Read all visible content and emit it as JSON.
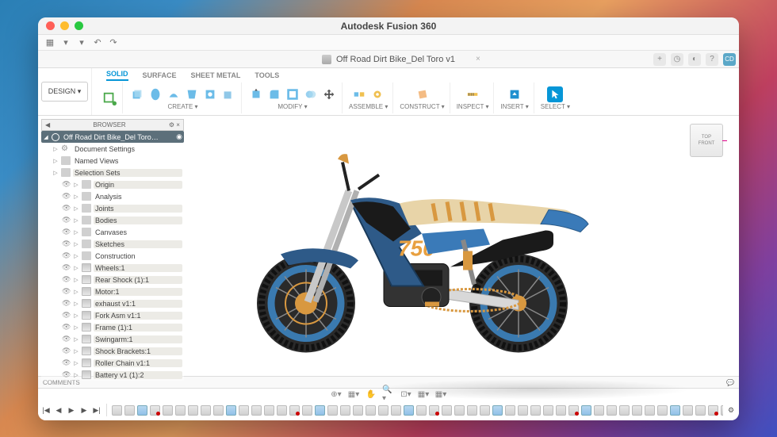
{
  "window_title": "Autodesk Fusion 360",
  "document_tab": "Off Road Dirt Bike_Del Toro v1",
  "user_initials": "CD",
  "design_button": "DESIGN ▾",
  "ribbon_tabs": [
    "SOLID",
    "SURFACE",
    "SHEET METAL",
    "TOOLS"
  ],
  "ribbon_active_tab": 0,
  "ribbon_groups": {
    "create": "CREATE ▾",
    "modify": "MODIFY ▾",
    "assemble": "ASSEMBLE ▾",
    "construct": "CONSTRUCT ▾",
    "inspect": "INSPECT ▾",
    "insert": "INSERT ▾",
    "select": "SELECT ▾"
  },
  "browser_header": "BROWSER",
  "browser": {
    "root": "Off Road Dirt Bike_Del Toro…",
    "top": [
      {
        "label": "Document Settings",
        "icon": "gear"
      },
      {
        "label": "Named Views",
        "icon": "folder"
      },
      {
        "label": "Selection Sets",
        "icon": "folder",
        "shade": true
      }
    ],
    "mid": [
      {
        "label": "Origin",
        "shade": true
      },
      {
        "label": "Analysis",
        "shade": false
      },
      {
        "label": "Joints",
        "shade": true
      },
      {
        "label": "Bodies",
        "shade": true
      },
      {
        "label": "Canvases",
        "shade": false
      },
      {
        "label": "Sketches",
        "shade": true
      },
      {
        "label": "Construction",
        "shade": false
      }
    ],
    "comp": [
      {
        "label": "Wheels:1"
      },
      {
        "label": "Rear Shock (1):1"
      },
      {
        "label": "Motor:1"
      },
      {
        "label": "exhaust v1:1"
      },
      {
        "label": "Fork Asm v1:1"
      },
      {
        "label": "Frame (1):1"
      },
      {
        "label": "Swingarm:1"
      },
      {
        "label": "Shock Brackets:1"
      },
      {
        "label": "Roller Chain v1:1"
      },
      {
        "label": "Battery v1 (1):2"
      }
    ]
  },
  "viewcube": {
    "top": "TOP",
    "front": "FRONT"
  },
  "comments_label": "COMMENTS",
  "bike_number": "750",
  "timeline_count": 52
}
